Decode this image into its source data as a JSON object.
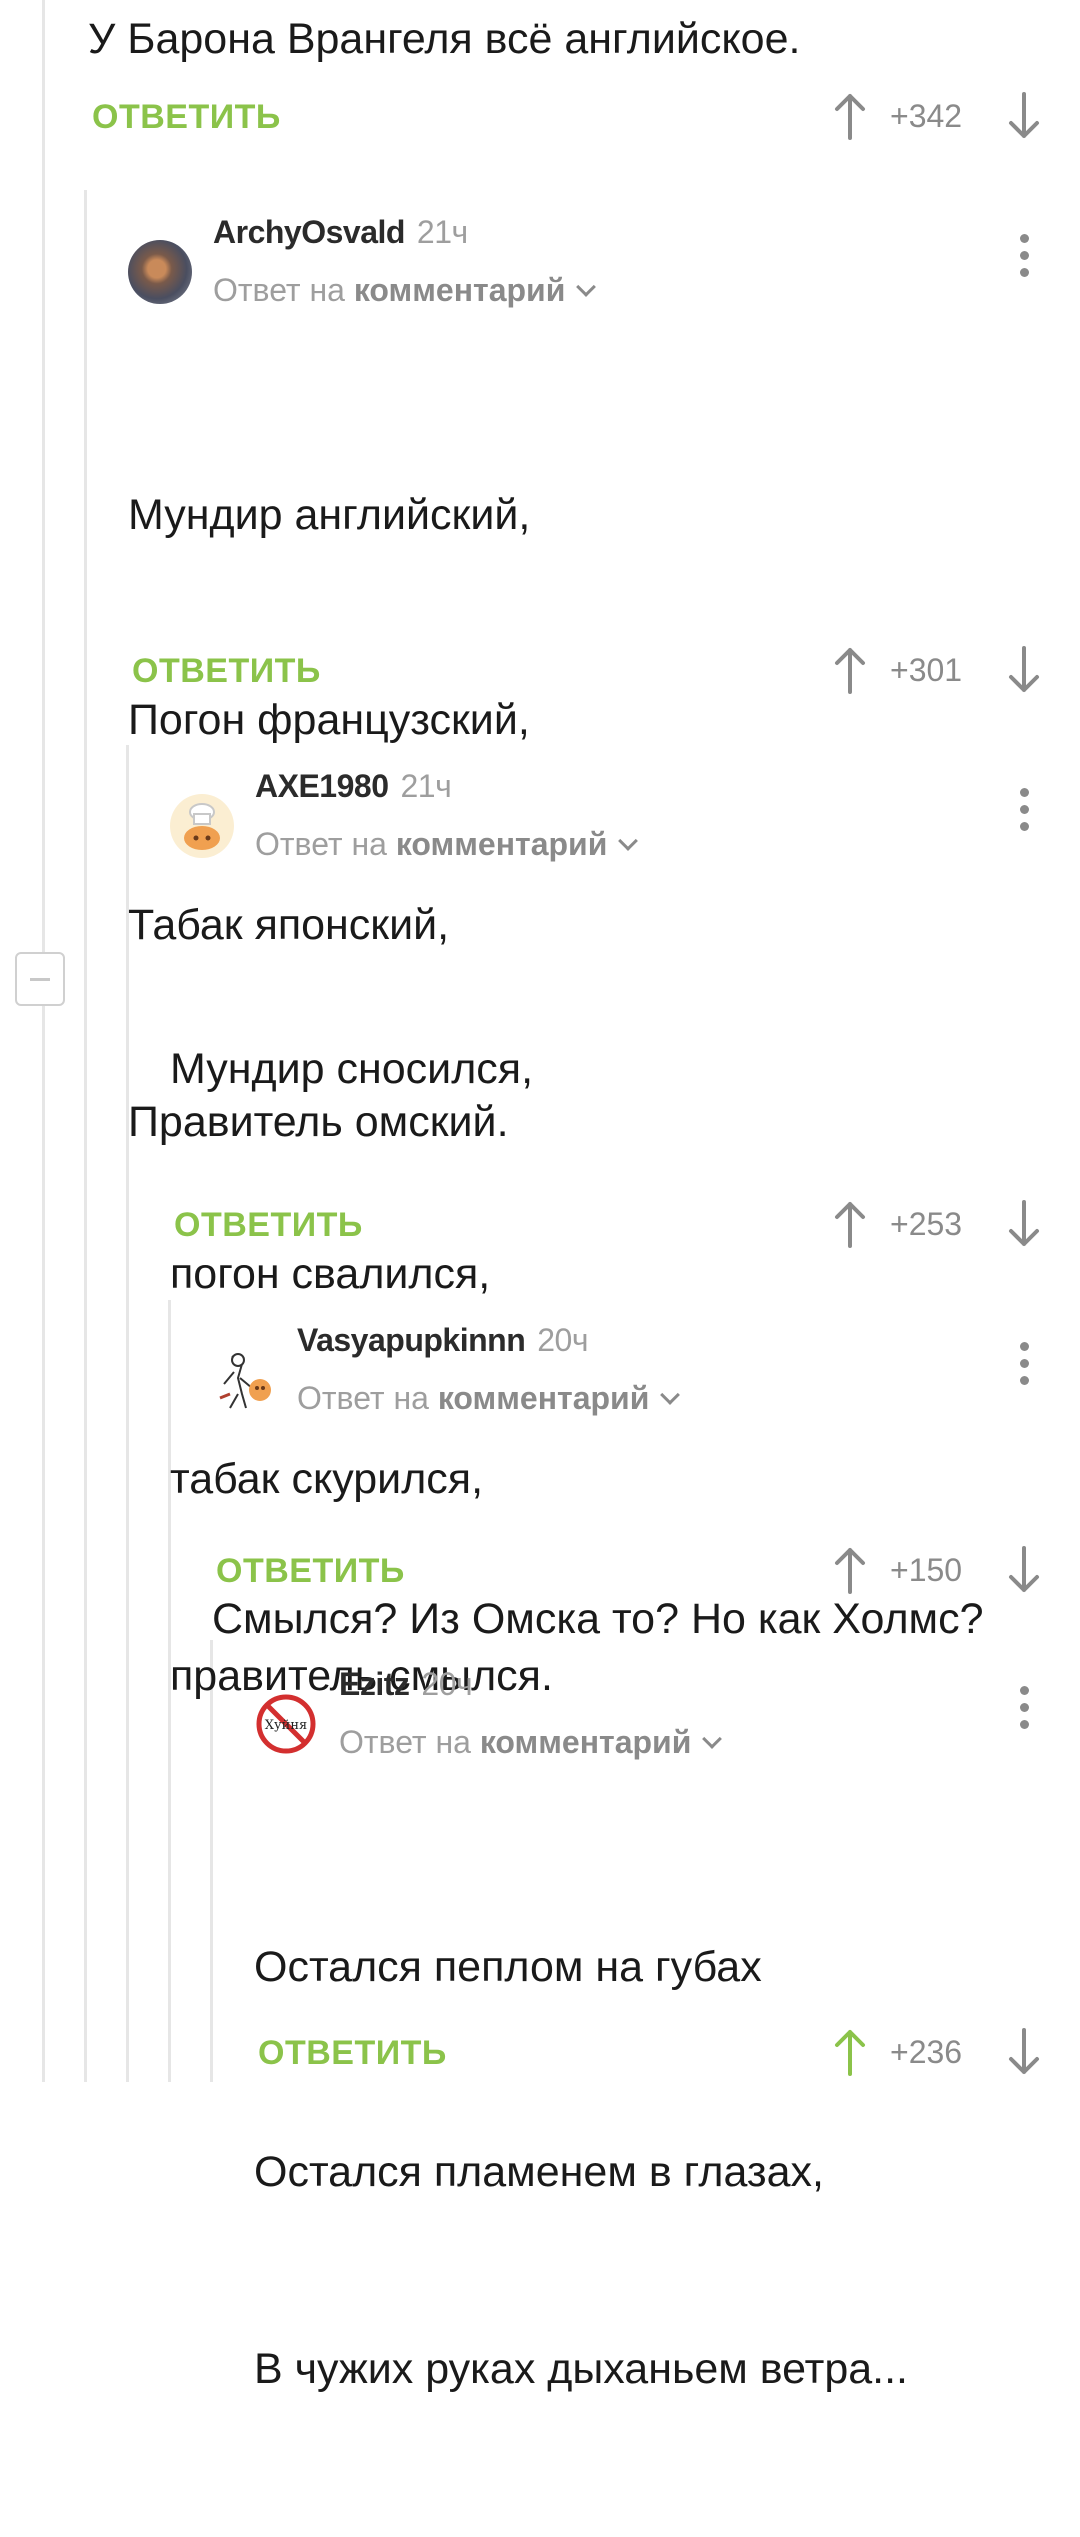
{
  "top_comment": {
    "text": "У Барона Врангеля всё английское.",
    "reply_label": "ОТВЕТИТЬ",
    "rating": "+342"
  },
  "comments": [
    {
      "author": "ArchyOsvald",
      "time": "21ч",
      "reply_prefix": "Ответ на",
      "reply_link": "комментарий",
      "lines": [
        "Мундир английский,",
        "Погон французский,",
        "Табак японский,",
        "Правитель омский."
      ],
      "reply_label": "ОТВЕТИТЬ",
      "rating": "+301",
      "upvoted": false
    },
    {
      "author": "AXE1980",
      "time": "21ч",
      "reply_prefix": "Ответ на",
      "reply_link": "комментарий",
      "lines": [
        "Мундир сносился,",
        "погон свалился,",
        "табак скурился,",
        "правитель смылся."
      ],
      "reply_label": "ОТВЕТИТЬ",
      "rating": "+253",
      "upvoted": false
    },
    {
      "author": "Vasyapupkinnn",
      "time": "20ч",
      "reply_prefix": "Ответ на",
      "reply_link": "комментарий",
      "lines": [
        "Смылся? Из Омска то? Но как Холмс?"
      ],
      "reply_label": "ОТВЕТИТЬ",
      "rating": "+150",
      "upvoted": false
    },
    {
      "author": "Ezitz",
      "time": "20ч",
      "reply_prefix": "Ответ на",
      "reply_link": "комментарий",
      "lines": [
        "Остался пеплом на губах",
        "Остался пламенем в глазах,",
        "В чужих руках дыханьем ветра..."
      ],
      "reply_label": "ОТВЕТИТЬ",
      "rating": "+236",
      "upvoted": true,
      "avatar_text": "Хуйня"
    }
  ],
  "colors": {
    "accent_green": "#8bc34a",
    "muted_gray": "#8a8a8a",
    "thread_line": "#e6e6e6"
  },
  "icons": [
    "upvote-arrow-icon",
    "downvote-arrow-icon",
    "more-vertical-icon",
    "chevron-down-icon",
    "collapse-minus-icon"
  ]
}
